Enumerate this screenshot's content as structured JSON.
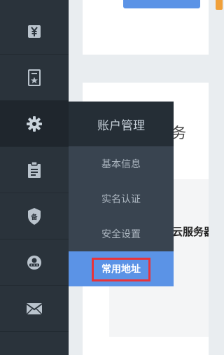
{
  "colors": {
    "sidebar_bg": "#2a333b",
    "submenu_bg": "#394450",
    "submenu_header_bg": "#252e36",
    "accent": "#5b93e6",
    "highlight": "#e8333a"
  },
  "sidebar": {
    "items": [
      {
        "icon": "yuan-icon"
      },
      {
        "icon": "invoice-icon"
      },
      {
        "icon": "gear-icon"
      },
      {
        "icon": "clipboard-icon"
      },
      {
        "icon": "filing-shield-icon"
      },
      {
        "icon": "support-icon"
      },
      {
        "icon": "mail-icon"
      }
    ]
  },
  "submenu": {
    "title": "账户管理",
    "items": [
      {
        "label": "基本信息"
      },
      {
        "label": "实名认证"
      },
      {
        "label": "安全设置"
      },
      {
        "label": "常用地址"
      }
    ]
  },
  "main": {
    "title_fragment": "务",
    "panel_text_fragment": "云服务器"
  }
}
